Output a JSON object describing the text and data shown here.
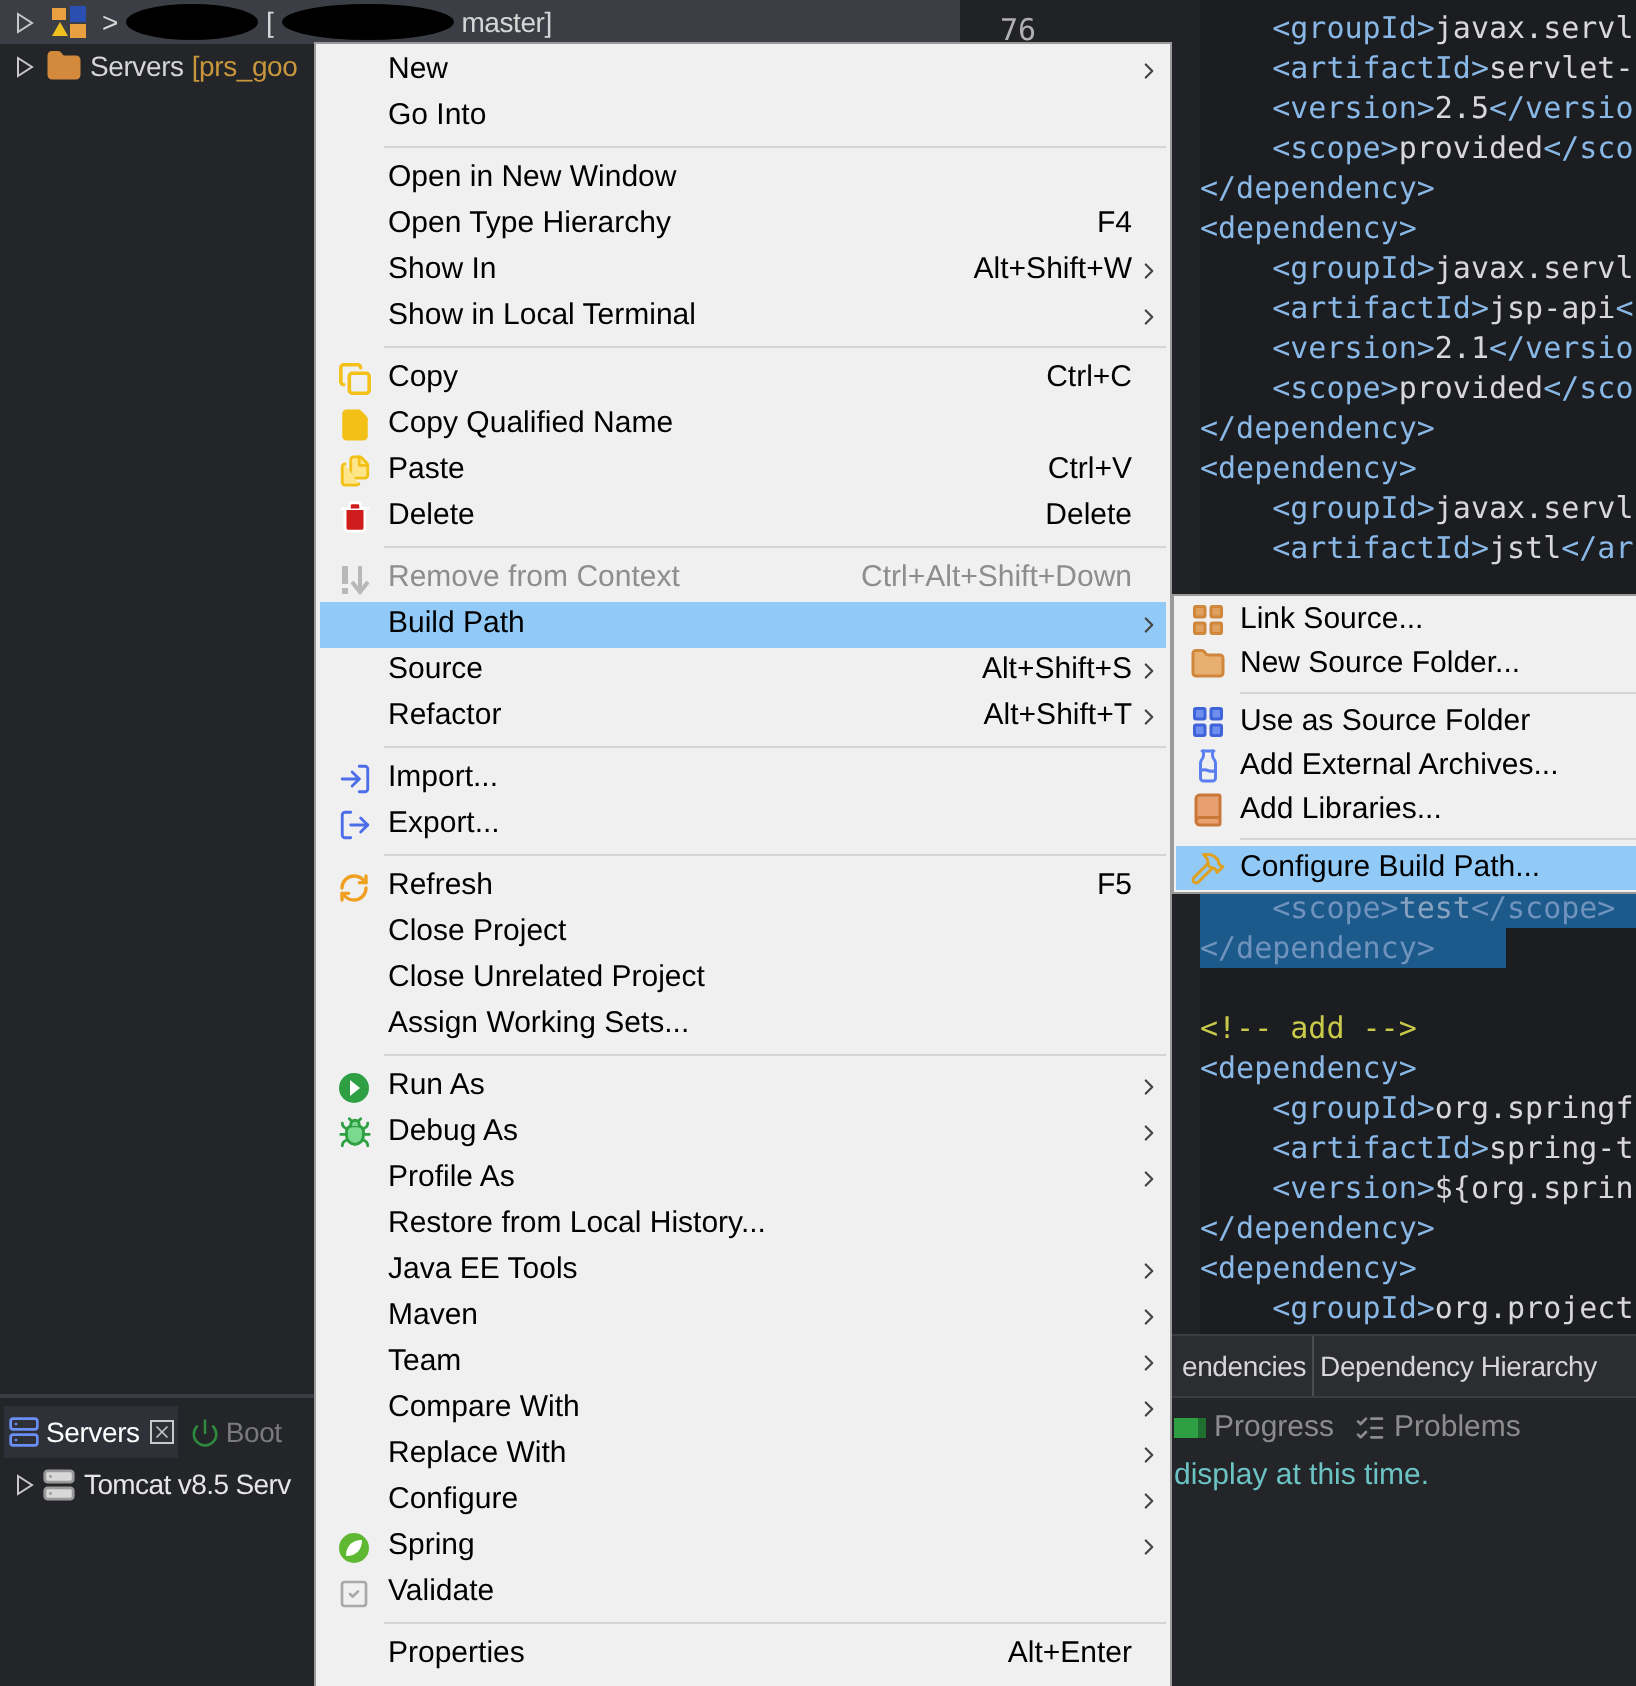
{
  "project_tree": {
    "items": [
      {
        "kind": "project",
        "prefix": ">",
        "bracket": "[",
        "suffix": "master]",
        "redacted": true,
        "expanded": false,
        "selected": true
      },
      {
        "kind": "folder",
        "label": "Servers",
        "detail": "[prs_goo",
        "expanded": false,
        "selected": false
      }
    ]
  },
  "servers_view": {
    "tabs": [
      {
        "label": "Servers",
        "selected": true,
        "closable": true
      },
      {
        "label": "Boot",
        "selected": false,
        "closable": false
      }
    ],
    "items": [
      {
        "label": "Tomcat v8.5 Serv",
        "expanded": false
      }
    ]
  },
  "editor": {
    "line_number": "76",
    "segments": [
      {
        "lines": [
          {
            "kind": "tag",
            "text": "    <groupId>javax.servl",
            "selected": false
          },
          {
            "kind": "tag",
            "text": "    <artifactId>servlet-",
            "selected": false
          },
          {
            "kind": "tag",
            "text": "    <version>2.5</versio",
            "selected": false
          },
          {
            "kind": "tag",
            "text": "    <scope>provided</sco",
            "selected": false
          },
          {
            "kind": "tag",
            "text": "</dependency>",
            "selected": false
          },
          {
            "kind": "tag",
            "text": "<dependency>",
            "selected": false
          },
          {
            "kind": "tag",
            "text": "    <groupId>javax.servl",
            "selected": false
          },
          {
            "kind": "tag",
            "text": "    <artifactId>jsp-api<",
            "selected": false
          },
          {
            "kind": "tag",
            "text": "    <version>2.1</versio",
            "selected": false
          },
          {
            "kind": "tag",
            "text": "    <scope>provided</sco",
            "selected": false
          },
          {
            "kind": "tag",
            "text": "</dependency>",
            "selected": false
          },
          {
            "kind": "tag",
            "text": "<dependency>",
            "selected": false
          },
          {
            "kind": "tag",
            "text": "    <groupId>javax.servl",
            "selected": false
          },
          {
            "kind": "tag",
            "text": "    <artifactId>jstl</ar",
            "selected": false
          }
        ]
      },
      {
        "lines": [
          {
            "kind": "tag",
            "text": "    <scope>test</scope>",
            "selected": true
          },
          {
            "kind": "tag",
            "text": "</dependency>",
            "selected": true
          },
          {
            "kind": "blank",
            "selected": false
          },
          {
            "kind": "comment",
            "text": "<!-- add -->",
            "selected": false
          },
          {
            "kind": "tag",
            "text": "<dependency>",
            "selected": false
          },
          {
            "kind": "tag",
            "text": "    <groupId>org.springf",
            "selected": false
          },
          {
            "kind": "tag",
            "text": "    <artifactId>spring-t",
            "selected": false
          },
          {
            "kind": "tag",
            "text": "    <version>${org.sprin",
            "selected": false
          },
          {
            "kind": "tag",
            "text": "</dependency>",
            "selected": false
          },
          {
            "kind": "tag",
            "text": "<dependency>",
            "selected": false
          },
          {
            "kind": "tag",
            "text": "    <groupId>org.project",
            "selected": false
          }
        ]
      }
    ]
  },
  "editor_tabs": [
    "endencies",
    "Dependency Hierarchy"
  ],
  "console_toolbar": [
    "Progress",
    "Problems"
  ],
  "console_message": "display at this time.",
  "context_menu": {
    "groups": [
      {
        "items": [
          {
            "label": "New",
            "submenu": true,
            "disabled": false,
            "selected": false
          },
          {
            "label": "Go Into",
            "submenu": false,
            "disabled": false,
            "selected": false
          }
        ]
      },
      {
        "items": [
          {
            "label": "Open in New Window",
            "submenu": false,
            "disabled": false,
            "selected": false
          },
          {
            "label": "Open Type Hierarchy",
            "shortcut": "F4",
            "submenu": false,
            "disabled": false,
            "selected": false
          },
          {
            "label": "Show In",
            "shortcut": "Alt+Shift+W",
            "submenu": true,
            "disabled": false,
            "selected": false
          },
          {
            "label": "Show in Local Terminal",
            "submenu": true,
            "disabled": false,
            "selected": false
          }
        ]
      },
      {
        "items": [
          {
            "label": "Copy",
            "shortcut": "Ctrl+C",
            "submenu": false,
            "disabled": false,
            "selected": false
          },
          {
            "label": "Copy Qualified Name",
            "submenu": false,
            "disabled": false,
            "selected": false
          },
          {
            "label": "Paste",
            "shortcut": "Ctrl+V",
            "submenu": false,
            "disabled": false,
            "selected": false
          },
          {
            "label": "Delete",
            "shortcut": "Delete",
            "submenu": false,
            "disabled": false,
            "selected": false
          }
        ]
      },
      {
        "items": [
          {
            "label": "Remove from Context",
            "shortcut": "Ctrl+Alt+Shift+Down",
            "submenu": false,
            "disabled": true,
            "selected": false
          },
          {
            "label": "Build Path",
            "submenu": true,
            "disabled": false,
            "selected": true
          },
          {
            "label": "Source",
            "shortcut": "Alt+Shift+S",
            "submenu": true,
            "disabled": false,
            "selected": false
          },
          {
            "label": "Refactor",
            "shortcut": "Alt+Shift+T",
            "submenu": true,
            "disabled": false,
            "selected": false
          }
        ]
      },
      {
        "items": [
          {
            "label": "Import...",
            "submenu": false,
            "disabled": false,
            "selected": false
          },
          {
            "label": "Export...",
            "submenu": false,
            "disabled": false,
            "selected": false
          }
        ]
      },
      {
        "items": [
          {
            "label": "Refresh",
            "shortcut": "F5",
            "submenu": false,
            "disabled": false,
            "selected": false
          },
          {
            "label": "Close Project",
            "submenu": false,
            "disabled": false,
            "selected": false
          },
          {
            "label": "Close Unrelated Project",
            "submenu": false,
            "disabled": false,
            "selected": false
          },
          {
            "label": "Assign Working Sets...",
            "submenu": false,
            "disabled": false,
            "selected": false
          }
        ]
      },
      {
        "items": [
          {
            "label": "Run As",
            "submenu": true,
            "disabled": false,
            "selected": false
          },
          {
            "label": "Debug As",
            "submenu": true,
            "disabled": false,
            "selected": false
          },
          {
            "label": "Profile As",
            "submenu": true,
            "disabled": false,
            "selected": false
          },
          {
            "label": "Restore from Local History...",
            "submenu": false,
            "disabled": false,
            "selected": false
          },
          {
            "label": "Java EE Tools",
            "submenu": true,
            "disabled": false,
            "selected": false
          },
          {
            "label": "Maven",
            "submenu": true,
            "disabled": false,
            "selected": false
          },
          {
            "label": "Team",
            "submenu": true,
            "disabled": false,
            "selected": false
          },
          {
            "label": "Compare With",
            "submenu": true,
            "disabled": false,
            "selected": false
          },
          {
            "label": "Replace With",
            "submenu": true,
            "disabled": false,
            "selected": false
          },
          {
            "label": "Configure",
            "submenu": true,
            "disabled": false,
            "selected": false
          },
          {
            "label": "Spring",
            "submenu": true,
            "disabled": false,
            "selected": false
          },
          {
            "label": "Validate",
            "submenu": false,
            "disabled": false,
            "selected": false
          }
        ]
      },
      {
        "items": [
          {
            "label": "Properties",
            "shortcut": "Alt+Enter",
            "submenu": false,
            "disabled": false,
            "selected": false
          }
        ]
      }
    ]
  },
  "build_path_submenu": {
    "groups": [
      {
        "items": [
          {
            "label": "Link Source...",
            "selected": false
          },
          {
            "label": "New Source Folder...",
            "selected": false
          }
        ]
      },
      {
        "items": [
          {
            "label": "Use as Source Folder",
            "selected": false
          },
          {
            "label": "Add External Archives...",
            "selected": false
          },
          {
            "label": "Add Libraries...",
            "selected": false
          }
        ]
      },
      {
        "items": [
          {
            "label": "Configure Build Path...",
            "selected": true
          }
        ]
      }
    ]
  }
}
